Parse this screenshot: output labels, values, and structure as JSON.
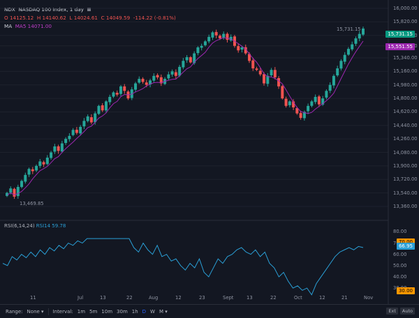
{
  "header": {
    "symbol": "NDX",
    "name": "NASDAQ 100 Index, 1 day",
    "ohlc": {
      "o": "O 14125.12",
      "h": "H 14140.62",
      "l": "L 14024.61",
      "c": "C 14049.59",
      "chg": "-114.22 (-0.81%)"
    },
    "ma_label": "MA",
    "ma_value": "MA5 14071.00"
  },
  "price_axis": {
    "ticks": [
      "16,000.00",
      "15,820.00",
      "15,640.00",
      "15,500.00",
      "15,340.00",
      "15,160.00",
      "14,980.00",
      "14,800.00",
      "14,620.00",
      "14,440.00",
      "14,260.00",
      "14,080.00",
      "13,900.00",
      "13,720.00",
      "13,540.00",
      "13,360.00"
    ],
    "last_price": "15,731.15",
    "ma_price": "15,551.55",
    "max_label": "15,731.15",
    "min_label": "13,469.85"
  },
  "rsi": {
    "label": "RSI(6,14,24)",
    "value_label": "RSI14 59.78",
    "ticks": [
      "80.00",
      "70.00",
      "60.00",
      "50.00",
      "40.00",
      "30.00"
    ],
    "current": "66.95",
    "upper": "70.00",
    "lower": "30.00"
  },
  "time_axis": [
    "11",
    "Jul",
    "13",
    "22",
    "Aug",
    "12",
    "23",
    "Sept",
    "13",
    "22",
    "Oct",
    "12",
    "21",
    "Nov"
  ],
  "bottom": {
    "range_label": "Range:",
    "range_value": "None",
    "interval_label": "Interval:",
    "intervals": [
      "1m",
      "5m",
      "10m",
      "30m",
      "1h",
      "D",
      "W",
      "M"
    ],
    "active_interval": "D",
    "ext": "Ext",
    "auto": "Auto"
  },
  "colors": {
    "up": "#26a69a",
    "down": "#ef5350",
    "ma": "#9c27b0",
    "rsi": "#2a9fd6",
    "bg": "#131722"
  },
  "chart_data": {
    "type": "candlestick",
    "closes": [
      13540,
      13600,
      13490,
      13620,
      13700,
      13780,
      13860,
      13830,
      13900,
      13960,
      13920,
      14010,
      14080,
      14160,
      14100,
      14200,
      14260,
      14300,
      14380,
      14340,
      14420,
      14500,
      14560,
      14480,
      14600,
      14700,
      14640,
      14760,
      14820,
      14880,
      14850,
      14960,
      14900,
      14800,
      14920,
      15000,
      15060,
      15020,
      14980,
      15040,
      15100,
      15080,
      15000,
      15060,
      15120,
      15160,
      15100,
      15220,
      15300,
      15350,
      15280,
      15400,
      15480,
      15500,
      15560,
      15620,
      15680,
      15640,
      15600,
      15660,
      15580,
      15620,
      15500,
      15440,
      15480,
      15400,
      15300,
      15200,
      15180,
      15120,
      15000,
      15100,
      15180,
      15080,
      14960,
      14800,
      14700,
      14760,
      14680,
      14600,
      14540,
      14620,
      14700,
      14760,
      14820,
      14720,
      14800,
      14900,
      14980,
      15100,
      15200,
      15300,
      15380,
      15460,
      15520,
      15600,
      15660,
      15731
    ],
    "rsi_values": [
      52,
      50,
      58,
      55,
      60,
      57,
      62,
      58,
      64,
      60,
      66,
      63,
      68,
      65,
      70,
      68,
      72,
      70,
      74,
      74,
      74,
      74,
      74,
      74,
      74,
      74,
      74,
      74,
      66,
      62,
      70,
      64,
      60,
      68,
      58,
      60,
      54,
      56,
      50,
      46,
      52,
      48,
      56,
      44,
      40,
      48,
      56,
      52,
      58,
      60,
      64,
      66,
      62,
      60,
      64,
      58,
      62,
      52,
      48,
      40,
      44,
      36,
      30,
      32,
      28,
      30,
      24,
      34,
      40,
      46,
      52,
      58,
      62,
      64,
      66,
      64,
      67,
      66
    ]
  }
}
